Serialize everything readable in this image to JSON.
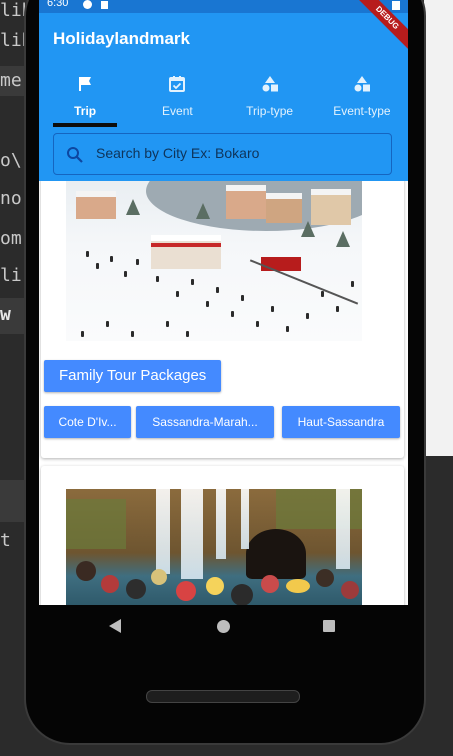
{
  "background_ide": {
    "lines": [
      "lib\\",
      "lib",
      "me",
      "o\\.",
      "no.",
      "om",
      "li.",
      "w",
      "t"
    ]
  },
  "status_bar": {
    "time": "6:30"
  },
  "app": {
    "title": "Holidaylandmark",
    "debug_banner": "DEBUG",
    "colors": {
      "primary": "#2196f3",
      "status": "#1976d2",
      "button": "#448aff"
    }
  },
  "tabs": [
    {
      "label": "Trip",
      "icon": "flag-icon",
      "active": true
    },
    {
      "label": "Event",
      "icon": "calendar-check-icon",
      "active": false
    },
    {
      "label": "Trip-type",
      "icon": "category-icon",
      "active": false
    },
    {
      "label": "Event-type",
      "icon": "category-icon",
      "active": false
    }
  ],
  "search": {
    "placeholder": "Search by City Ex: Bokaro",
    "value": ""
  },
  "cards": [
    {
      "image": "snowy-hill-town-crowd-photo",
      "package_title": "Family Tour Packages",
      "locations": [
        "Cote D'Iv...",
        "Sassandra-Marah...",
        "Haut-Sassandra"
      ]
    },
    {
      "image": "waterfall-crowd-photo"
    }
  ],
  "navigation": {
    "back": "back-icon",
    "home": "home-icon",
    "recents": "recents-icon"
  }
}
